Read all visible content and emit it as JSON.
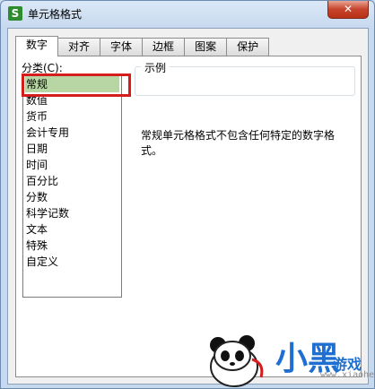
{
  "window": {
    "title": "单元格格式",
    "app_icon_glyph": "S",
    "close_glyph": "✕"
  },
  "tabs": [
    {
      "label": "数字",
      "active": true
    },
    {
      "label": "对齐",
      "active": false
    },
    {
      "label": "字体",
      "active": false
    },
    {
      "label": "边框",
      "active": false
    },
    {
      "label": "图案",
      "active": false
    },
    {
      "label": "保护",
      "active": false
    }
  ],
  "category": {
    "label": "分类(C):",
    "items": [
      "常规",
      "数值",
      "货币",
      "会计专用",
      "日期",
      "时间",
      "百分比",
      "分数",
      "科学记数",
      "文本",
      "特殊",
      "自定义"
    ],
    "selected": "常规"
  },
  "sample": {
    "legend": "示例",
    "value": ""
  },
  "description": "常规单元格格式不包含任何特定的数字格式。",
  "watermark": {
    "brand": "小黑",
    "game": "游戏",
    "url": "www.xiaohei.com"
  },
  "colors": {
    "selection": "#b7d6a4",
    "highlight_box": "#d61d1d",
    "close_button": "#c7432b",
    "app_icon": "#2e8b2e"
  }
}
